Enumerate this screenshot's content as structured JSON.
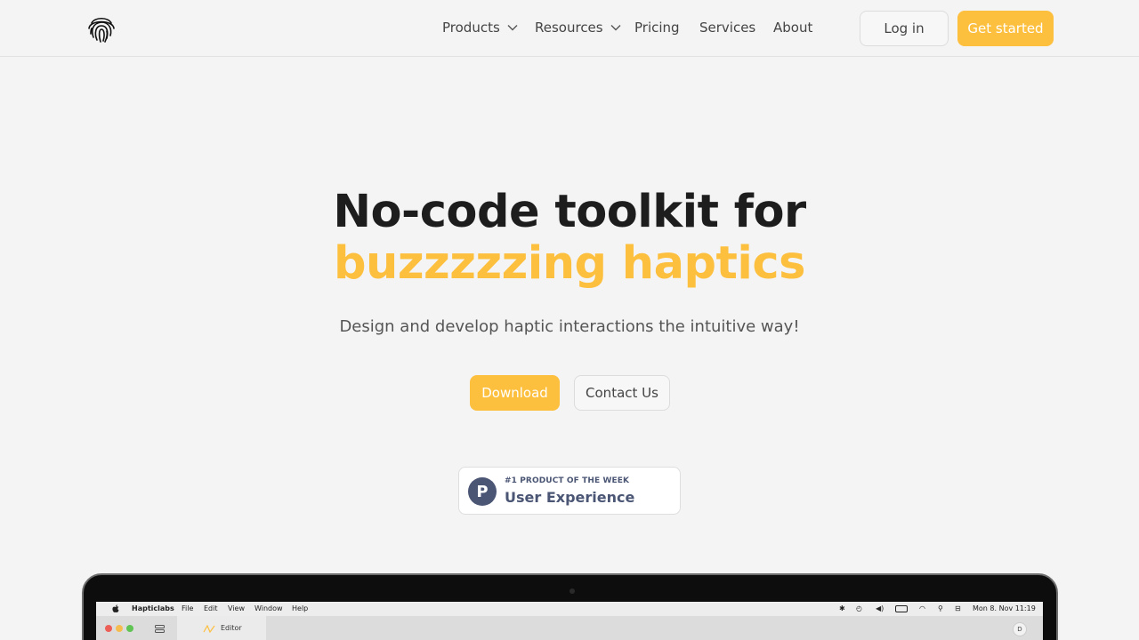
{
  "nav": {
    "products": "Products",
    "resources": "Resources",
    "pricing": "Pricing",
    "services": "Services",
    "about": "About",
    "login": "Log in",
    "get_started": "Get started"
  },
  "hero": {
    "title_line1": "No-code toolkit for",
    "title_line2": "buzzzzzing haptics",
    "subtitle": "Design and develop haptic interactions the intuitive way!",
    "download": "Download",
    "contact": "Contact Us"
  },
  "badge": {
    "logo_letter": "P",
    "small": "#1 PRODUCT OF THE WEEK",
    "big": "User Experience"
  },
  "app": {
    "menu": [
      "Hapticlabs",
      "File",
      "Edit",
      "View",
      "Window",
      "Help"
    ],
    "clock": "Mon 8. Nov  11:19",
    "tab": "Editor",
    "avatar": "D"
  },
  "colors": {
    "accent": "#fdbf3e",
    "badge": "#4b5675",
    "background": "#f4f4f4"
  },
  "icons": [
    "fingerprint-logo-icon",
    "chevron-down-icon",
    "apple-icon",
    "bluetooth-icon",
    "wifi-icon",
    "search-icon",
    "battery-icon",
    "sidebar-icon",
    "waveform-icon"
  ]
}
